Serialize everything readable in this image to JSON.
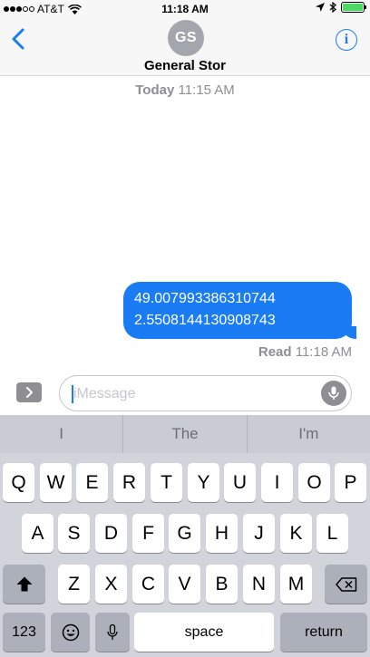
{
  "status_bar": {
    "carrier": "AT&T",
    "time": "11:18 AM"
  },
  "header": {
    "avatar_initials": "GS",
    "contact_name": "General Stor"
  },
  "conversation": {
    "timestamp_day": "Today",
    "timestamp_time": "11:15 AM",
    "messages": [
      {
        "lines": [
          "49.007993386310744",
          "2.5508144130908743"
        ],
        "outgoing": true
      }
    ],
    "read_label": "Read",
    "read_time": "11:18 AM"
  },
  "composer": {
    "placeholder": "iMessage"
  },
  "keyboard": {
    "predictions": [
      "I",
      "The",
      "I'm"
    ],
    "row1": [
      "Q",
      "W",
      "E",
      "R",
      "T",
      "Y",
      "U",
      "I",
      "O",
      "P"
    ],
    "row2": [
      "A",
      "S",
      "D",
      "F",
      "G",
      "H",
      "J",
      "K",
      "L"
    ],
    "row3": [
      "Z",
      "X",
      "C",
      "V",
      "B",
      "N",
      "M"
    ],
    "numbers_key": "123",
    "space_key": "space",
    "return_key": "return"
  },
  "colors": {
    "accent": "#1a7cf5",
    "battery": "#4cd964",
    "keyboard_bg": "#d1d4da"
  }
}
